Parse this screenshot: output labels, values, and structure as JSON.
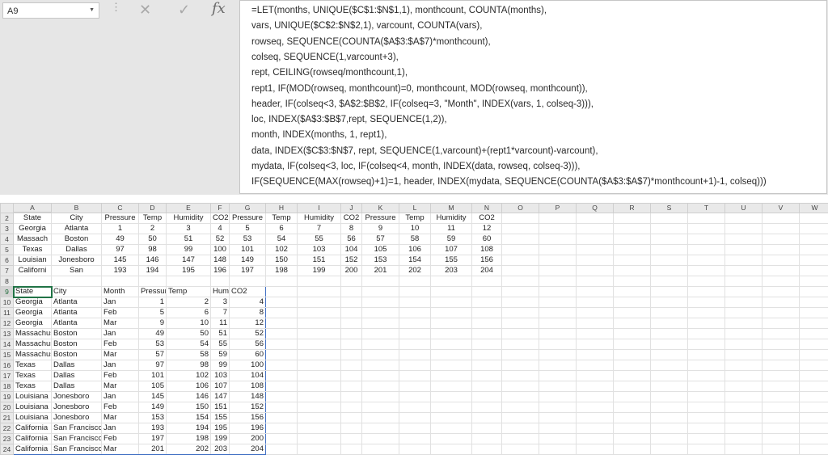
{
  "name_box": {
    "value": "A9"
  },
  "formula": {
    "lines": [
      "=LET(months, UNIQUE($C$1:$N$1,1), monthcount, COUNTA(months),",
      "vars, UNIQUE($C$2:$N$2,1), varcount, COUNTA(vars),",
      "rowseq, SEQUENCE(COUNTA($A$3:$A$7)*monthcount),",
      "colseq, SEQUENCE(1,varcount+3),",
      "rept, CEILING(rowseq/monthcount,1),",
      "rept1, IF(MOD(rowseq, monthcount)=0, monthcount, MOD(rowseq, monthcount)),",
      "header, IF(colseq<3, $A$2:$B$2, IF(colseq=3, \"Month\", INDEX(vars, 1, colseq-3))),",
      "loc, INDEX($A$3:$B$7,rept, SEQUENCE(1,2)),",
      "month, INDEX(months, 1, rept1),",
      "data, INDEX($C$3:$N$7, rept, SEQUENCE(1,varcount)+(rept1*varcount)-varcount),",
      "mydata, IF(colseq<3, loc, IF(colseq<4, month, INDEX(data, rowseq, colseq-3))),",
      "IF(SEQUENCE(MAX(rowseq)+1)=1, header, INDEX(mydata, SEQUENCE(COUNTA($A$3:$A$7)*monthcount+1)-1, colseq)))"
    ]
  },
  "columns": [
    "A",
    "B",
    "C",
    "D",
    "E",
    "F",
    "G",
    "H",
    "I",
    "J",
    "K",
    "L",
    "M",
    "N",
    "O",
    "P",
    "Q",
    "R",
    "S",
    "T",
    "U",
    "V",
    "W"
  ],
  "rows": [
    {
      "num": "2",
      "cells": [
        "State",
        "City",
        "Pressure",
        "Temp",
        "Humidity",
        "CO2",
        "Pressure",
        "Temp",
        "Humidity",
        "CO2",
        "Pressure",
        "Temp",
        "Humidity",
        "CO2",
        "",
        "",
        "",
        "",
        "",
        "",
        "",
        "",
        ""
      ]
    },
    {
      "num": "3",
      "cells": [
        "Georgia",
        "Atlanta",
        "1",
        "2",
        "3",
        "4",
        "5",
        "6",
        "7",
        "8",
        "9",
        "10",
        "11",
        "12",
        "",
        "",
        "",
        "",
        "",
        "",
        "",
        "",
        ""
      ]
    },
    {
      "num": "4",
      "cells": [
        "Massach",
        "Boston",
        "49",
        "50",
        "51",
        "52",
        "53",
        "54",
        "55",
        "56",
        "57",
        "58",
        "59",
        "60",
        "",
        "",
        "",
        "",
        "",
        "",
        "",
        "",
        ""
      ]
    },
    {
      "num": "5",
      "cells": [
        "Texas",
        "Dallas",
        "97",
        "98",
        "99",
        "100",
        "101",
        "102",
        "103",
        "104",
        "105",
        "106",
        "107",
        "108",
        "",
        "",
        "",
        "",
        "",
        "",
        "",
        "",
        ""
      ]
    },
    {
      "num": "6",
      "cells": [
        "Louisian",
        "Jonesboro",
        "145",
        "146",
        "147",
        "148",
        "149",
        "150",
        "151",
        "152",
        "153",
        "154",
        "155",
        "156",
        "",
        "",
        "",
        "",
        "",
        "",
        "",
        "",
        ""
      ]
    },
    {
      "num": "7",
      "cells": [
        "Californi",
        "San",
        "193",
        "194",
        "195",
        "196",
        "197",
        "198",
        "199",
        "200",
        "201",
        "202",
        "203",
        "204",
        "",
        "",
        "",
        "",
        "",
        "",
        "",
        "",
        ""
      ]
    },
    {
      "num": "8",
      "cells": [
        "",
        "",
        "",
        "",
        "",
        "",
        "",
        "",
        "",
        "",
        "",
        "",
        "",
        "",
        "",
        "",
        "",
        "",
        "",
        "",
        "",
        "",
        ""
      ]
    },
    {
      "num": "9",
      "cells": [
        "State",
        "City",
        "Month",
        "Pressure",
        "Temp",
        "Humidity",
        "CO2",
        "",
        "",
        "",
        "",
        "",
        "",
        "",
        "",
        "",
        "",
        "",
        "",
        "",
        "",
        "",
        ""
      ]
    },
    {
      "num": "10",
      "cells": [
        "Georgia",
        "Atlanta",
        "Jan",
        "1",
        "2",
        "3",
        "4",
        "",
        "",
        "",
        "",
        "",
        "",
        "",
        "",
        "",
        "",
        "",
        "",
        "",
        "",
        "",
        ""
      ]
    },
    {
      "num": "11",
      "cells": [
        "Georgia",
        "Atlanta",
        "Feb",
        "5",
        "6",
        "7",
        "8",
        "",
        "",
        "",
        "",
        "",
        "",
        "",
        "",
        "",
        "",
        "",
        "",
        "",
        "",
        "",
        ""
      ]
    },
    {
      "num": "12",
      "cells": [
        "Georgia",
        "Atlanta",
        "Mar",
        "9",
        "10",
        "11",
        "12",
        "",
        "",
        "",
        "",
        "",
        "",
        "",
        "",
        "",
        "",
        "",
        "",
        "",
        "",
        "",
        ""
      ]
    },
    {
      "num": "13",
      "cells": [
        "Massachusetts",
        "Boston",
        "Jan",
        "49",
        "50",
        "51",
        "52",
        "",
        "",
        "",
        "",
        "",
        "",
        "",
        "",
        "",
        "",
        "",
        "",
        "",
        "",
        "",
        ""
      ]
    },
    {
      "num": "14",
      "cells": [
        "Massachusetts",
        "Boston",
        "Feb",
        "53",
        "54",
        "55",
        "56",
        "",
        "",
        "",
        "",
        "",
        "",
        "",
        "",
        "",
        "",
        "",
        "",
        "",
        "",
        "",
        ""
      ]
    },
    {
      "num": "15",
      "cells": [
        "Massachusetts",
        "Boston",
        "Mar",
        "57",
        "58",
        "59",
        "60",
        "",
        "",
        "",
        "",
        "",
        "",
        "",
        "",
        "",
        "",
        "",
        "",
        "",
        "",
        "",
        ""
      ]
    },
    {
      "num": "16",
      "cells": [
        "Texas",
        "Dallas",
        "Jan",
        "97",
        "98",
        "99",
        "100",
        "",
        "",
        "",
        "",
        "",
        "",
        "",
        "",
        "",
        "",
        "",
        "",
        "",
        "",
        "",
        ""
      ]
    },
    {
      "num": "17",
      "cells": [
        "Texas",
        "Dallas",
        "Feb",
        "101",
        "102",
        "103",
        "104",
        "",
        "",
        "",
        "",
        "",
        "",
        "",
        "",
        "",
        "",
        "",
        "",
        "",
        "",
        "",
        ""
      ]
    },
    {
      "num": "18",
      "cells": [
        "Texas",
        "Dallas",
        "Mar",
        "105",
        "106",
        "107",
        "108",
        "",
        "",
        "",
        "",
        "",
        "",
        "",
        "",
        "",
        "",
        "",
        "",
        "",
        "",
        "",
        ""
      ]
    },
    {
      "num": "19",
      "cells": [
        "Louisiana",
        "Jonesboro",
        "Jan",
        "145",
        "146",
        "147",
        "148",
        "",
        "",
        "",
        "",
        "",
        "",
        "",
        "",
        "",
        "",
        "",
        "",
        "",
        "",
        "",
        ""
      ]
    },
    {
      "num": "20",
      "cells": [
        "Louisiana",
        "Jonesboro",
        "Feb",
        "149",
        "150",
        "151",
        "152",
        "",
        "",
        "",
        "",
        "",
        "",
        "",
        "",
        "",
        "",
        "",
        "",
        "",
        "",
        "",
        ""
      ]
    },
    {
      "num": "21",
      "cells": [
        "Louisiana",
        "Jonesboro",
        "Mar",
        "153",
        "154",
        "155",
        "156",
        "",
        "",
        "",
        "",
        "",
        "",
        "",
        "",
        "",
        "",
        "",
        "",
        "",
        "",
        "",
        ""
      ]
    },
    {
      "num": "22",
      "cells": [
        "California",
        "San Francisco",
        "Jan",
        "193",
        "194",
        "195",
        "196",
        "",
        "",
        "",
        "",
        "",
        "",
        "",
        "",
        "",
        "",
        "",
        "",
        "",
        "",
        "",
        ""
      ]
    },
    {
      "num": "23",
      "cells": [
        "California",
        "San Francisco",
        "Feb",
        "197",
        "198",
        "199",
        "200",
        "",
        "",
        "",
        "",
        "",
        "",
        "",
        "",
        "",
        "",
        "",
        "",
        "",
        "",
        "",
        ""
      ]
    },
    {
      "num": "24",
      "cells": [
        "California",
        "San Francisco",
        "Mar",
        "201",
        "202",
        "203",
        "204",
        "",
        "",
        "",
        "",
        "",
        "",
        "",
        "",
        "",
        "",
        "",
        "",
        "",
        "",
        "",
        ""
      ]
    }
  ]
}
